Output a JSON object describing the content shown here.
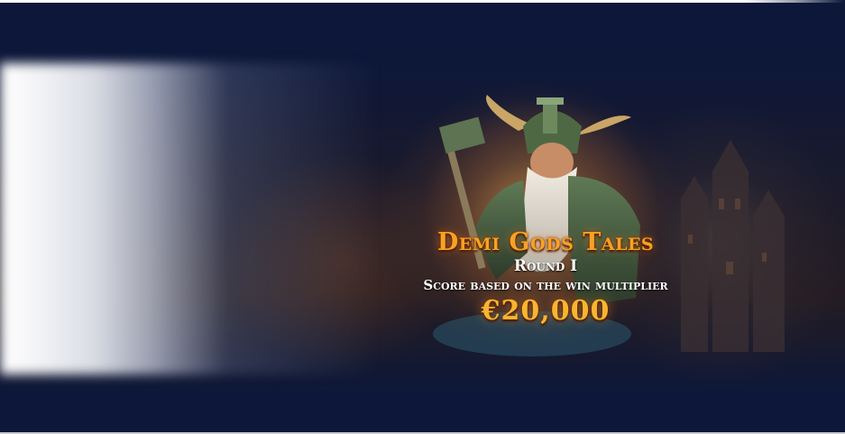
{
  "banner": {
    "game_title": "Demi Gods Tales",
    "round_label": "Round I",
    "description": "Score based on the win multiplier",
    "prize_amount": "€20,000"
  },
  "colors": {
    "background": "#0c1739",
    "title_gold": "#f6a224",
    "prize_gold": "#f7b531",
    "text_white": "#ffffff"
  },
  "icons": [
    "warrior-god-illustration",
    "castle-illustration"
  ]
}
